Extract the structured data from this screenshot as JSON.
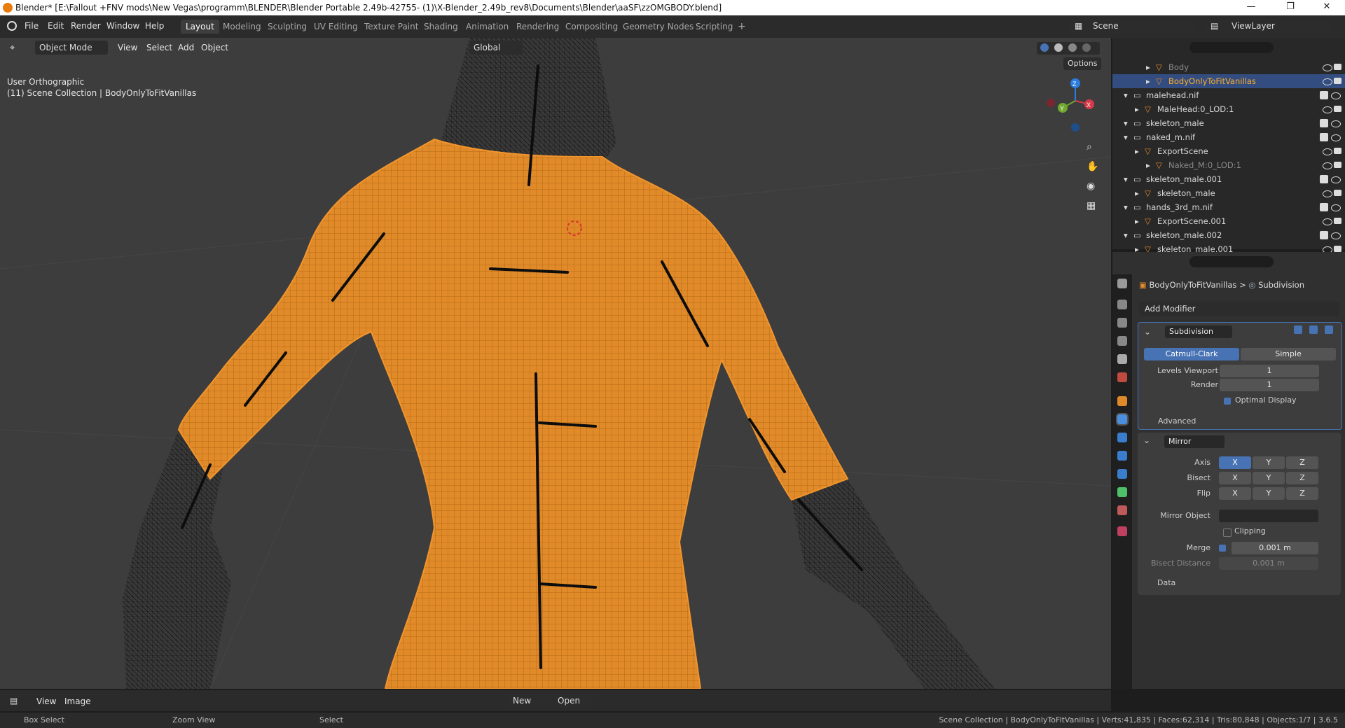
{
  "titlebar": {
    "title": "Blender* [E:\\Fallout +FNV mods\\New Vegas\\programm\\BLENDER\\Blender Portable 2.49b-42755- (1)\\X-Blender_2.49b_rev8\\Documents\\Blender\\aaSF\\zzOMGBODY.blend]",
    "minimize": "—",
    "restore": "❐",
    "close": "✕"
  },
  "menubar": {
    "items": [
      "File",
      "Edit",
      "Render",
      "Window",
      "Help"
    ],
    "workspaces": [
      "Layout",
      "Modeling",
      "Sculpting",
      "UV Editing",
      "Texture Paint",
      "Shading",
      "Animation",
      "Rendering",
      "Compositing",
      "Geometry Nodes",
      "Scripting"
    ],
    "active_workspace": "Layout",
    "add_workspace": "+",
    "scene_label": "Scene",
    "viewlayer_label": "ViewLayer"
  },
  "viewport": {
    "mode": "Object Mode",
    "menus": [
      "View",
      "Select",
      "Add",
      "Object"
    ],
    "orientation": "Global",
    "options": "Options",
    "view_name": "User Orthographic",
    "collection_info": "(11) Scene Collection | BodyOnlyToFitVanillas",
    "gizmo": {
      "x": "X",
      "y": "Y",
      "z": "Z"
    },
    "mesh_color": "#f2952c",
    "wire_color": "#1a1a1a"
  },
  "outliner": {
    "rows": [
      {
        "label": "Body",
        "indent": 3,
        "selected": false,
        "dim": true
      },
      {
        "label": "BodyOnlyToFitVanillas",
        "indent": 3,
        "selected": true,
        "dim": false
      },
      {
        "label": "malehead.nif",
        "indent": 1,
        "selected": false,
        "dim": false
      },
      {
        "label": "MaleHead:0_LOD:1",
        "indent": 2,
        "selected": false,
        "dim": false
      },
      {
        "label": "skeleton_male",
        "indent": 1,
        "selected": false,
        "dim": false
      },
      {
        "label": "naked_m.nif",
        "indent": 1,
        "selected": false,
        "dim": false
      },
      {
        "label": "ExportScene",
        "indent": 2,
        "selected": false,
        "dim": false
      },
      {
        "label": "Naked_M:0_LOD:1",
        "indent": 3,
        "selected": false,
        "dim": true
      },
      {
        "label": "skeleton_male.001",
        "indent": 1,
        "selected": false,
        "dim": false
      },
      {
        "label": "skeleton_male",
        "indent": 2,
        "selected": false,
        "dim": false
      },
      {
        "label": "hands_3rd_m.nif",
        "indent": 1,
        "selected": false,
        "dim": false
      },
      {
        "label": "ExportScene.001",
        "indent": 2,
        "selected": false,
        "dim": false
      },
      {
        "label": "skeleton_male.002",
        "indent": 1,
        "selected": false,
        "dim": false
      },
      {
        "label": "skeleton_male.001",
        "indent": 2,
        "selected": false,
        "dim": false
      }
    ]
  },
  "properties": {
    "breadcrumb_object": "BodyOnlyToFitVanillas",
    "breadcrumb_sep": ">",
    "breadcrumb_modifier": "Subdivision",
    "add_modifier": "Add Modifier",
    "subdivision": {
      "name": "Subdivision",
      "catmull": "Catmull-Clark",
      "simple": "Simple",
      "levels_viewport_label": "Levels Viewport",
      "levels_viewport": "1",
      "render_label": "Render",
      "render": "1",
      "optimal_display": "Optimal Display",
      "advanced": "Advanced"
    },
    "mirror": {
      "name": "Mirror",
      "axis_label": "Axis",
      "bisect_label": "Bisect",
      "flip_label": "Flip",
      "x": "X",
      "y": "Y",
      "z": "Z",
      "mirror_object_label": "Mirror Object",
      "clipping": "Clipping",
      "merge_label": "Merge",
      "merge_value": "0.001 m",
      "bisect_distance_label": "Bisect Distance",
      "bisect_distance_value": "0.001 m",
      "data": "Data"
    }
  },
  "timeline_header": {
    "menus": [
      "View",
      "Image"
    ],
    "new": "New",
    "open": "Open"
  },
  "statusbar": {
    "box_select": "Box Select",
    "zoom_view": "Zoom View",
    "select": "Select",
    "stats": "Scene Collection | BodyOnlyToFitVanillas | Verts:41,835 | Faces:62,314 | Tris:80,848 | Objects:1/7 | 3.6.5"
  },
  "colors": {
    "accent": "#4772b3",
    "selected_row": "#334d80",
    "orange": "#f2952c"
  }
}
